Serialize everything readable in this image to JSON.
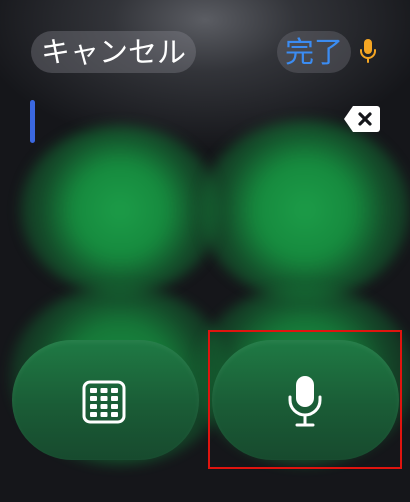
{
  "header": {
    "cancel_label": "キャンセル",
    "done_label": "完了",
    "mic_indicator_icon": "microphone-icon",
    "mic_indicator_color": "#f5a623"
  },
  "input": {
    "value": "",
    "cursor_color": "#3b68e0",
    "delete_icon": "backspace-icon"
  },
  "keys": [
    {
      "name": "keypad",
      "icon": "keypad-grid-icon"
    },
    {
      "name": "dictation",
      "icon": "microphone-icon"
    }
  ],
  "colors": {
    "background": "#15161a",
    "accent_green": "#1c9c48",
    "done_blue": "#3b8cf2",
    "highlight_red": "#e0140f"
  }
}
